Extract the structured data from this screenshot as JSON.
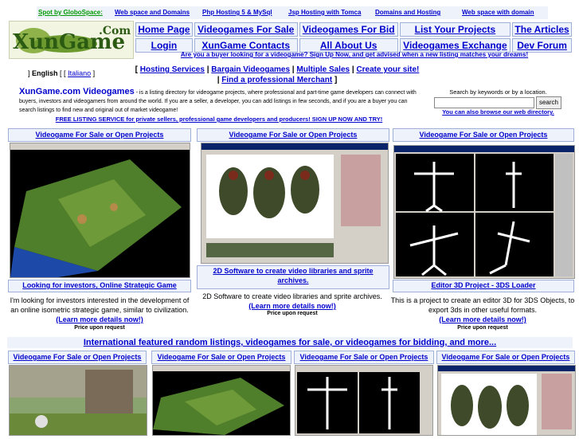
{
  "topbar": {
    "sponsor": "Spot by GloboSpace:",
    "links": [
      "Web space and Domains",
      "Php Hosting 5 & MySql",
      "Jsp Hosting with Tomca",
      "Domains and Hosting",
      "Web space with domain"
    ]
  },
  "logo": {
    "text": "XunGame",
    "suffix": ".Com"
  },
  "nav": [
    [
      "Home Page",
      "Videogames For Sale",
      "Videogames For Bid",
      "List Your Projects",
      "The Articles"
    ],
    [
      "Login",
      "XunGame Contacts",
      "All About Us",
      "Videogames Exchange",
      "Dev Forum"
    ]
  ],
  "promo": "Are you a buyer looking for a videogame? Sign Up Now, and get advised when a new listing matches your dreams!",
  "lang": {
    "current": "English",
    "sep1": "[ [",
    "other": "Italiano",
    "sep2": "]"
  },
  "links": {
    "open": "[",
    "items": [
      "Hosting Services",
      "Bargain Videogames",
      "Multiple Sales",
      "Create your site!",
      "Find a professional Merchant"
    ],
    "close": "]"
  },
  "intro": {
    "heading": "XunGame.com Videogames",
    "text": " - is a listing directory for videogame projects, where professional and part-time game developers can connect with buyers, investors and videogamers from around the world. If you are a seller, a developer, you can add listings in few seconds, and if you are a buyer you can search listings to find new and original out of market videogame!"
  },
  "free": "FREE LISTING SERVICE for private sellers, professional game developers and producers! SIGN UP NOW AND TRY!",
  "search": {
    "label": "Search by keywords or by a location.",
    "button": "search",
    "browse": "You can also browse our web directory."
  },
  "cards": [
    {
      "title": "Videogame For Sale or Open Projects",
      "caption": "Looking for investors, Online Strategic Game",
      "desc": "I'm looking for investors interested in the development of an online isometric strategic game, similar to civilization.",
      "learn": "(Learn more details now!)",
      "price": "Price upon request"
    },
    {
      "title": "Videogame For Sale or Open Projects",
      "caption": "2D Software to create video libraries and sprite archives.",
      "desc": "2D Software to create video libraries and sprite archives.",
      "learn": "(Learn more details now!)",
      "price": "Price upon request"
    },
    {
      "title": "Videogame For Sale or Open Projects",
      "caption": "Editor 3D Project - 3DS Loader",
      "desc": "This is a project to create an editor 3D for 3DS Objects, to export 3ds in other useful formats.",
      "learn": "(Learn more details now!)",
      "price": "Price upon request"
    }
  ],
  "featured": {
    "heading": "International featured random listings, videogames for sale, or videogames for bidding, and more...",
    "titles": [
      "Videogame For Sale or Open Projects",
      "Videogame For Sale or Open Projects",
      "Videogame For Sale or Open Projects",
      "Videogame For Sale or Open Projects"
    ]
  }
}
